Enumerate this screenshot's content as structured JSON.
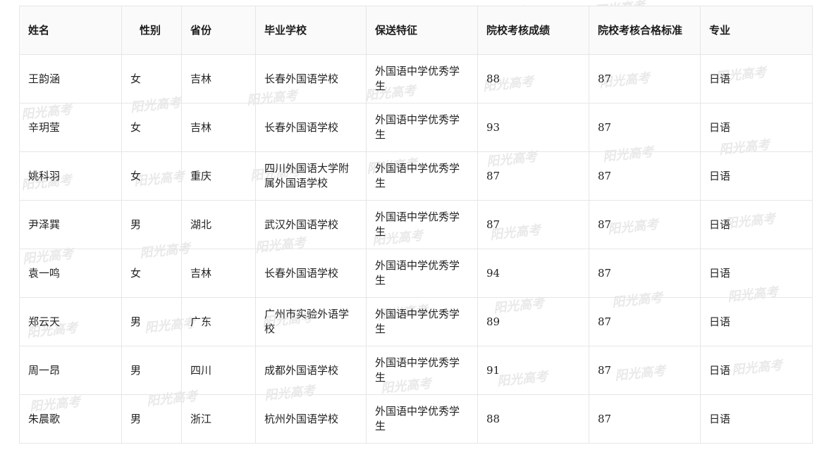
{
  "table": {
    "headers": [
      "姓名",
      "性别",
      "省份",
      "毕业学校",
      "保送特征",
      "院校考核成绩",
      "院校考核合格标准",
      "专业"
    ],
    "rows": [
      [
        "王韵涵",
        "女",
        "吉林",
        "长春外国语学校",
        "外国语中学优秀学生",
        "88",
        "87",
        "日语"
      ],
      [
        "辛玥莹",
        "女",
        "吉林",
        "长春外国语学校",
        "外国语中学优秀学生",
        "93",
        "87",
        "日语"
      ],
      [
        "姚科羽",
        "女",
        "重庆",
        "四川外国语大学附属外国语学校",
        "外国语中学优秀学生",
        "87",
        "87",
        "日语"
      ],
      [
        "尹泽巽",
        "男",
        "湖北",
        "武汉外国语学校",
        "外国语中学优秀学生",
        "87",
        "87",
        "日语"
      ],
      [
        "袁一鸣",
        "女",
        "吉林",
        "长春外国语学校",
        "外国语中学优秀学生",
        "94",
        "87",
        "日语"
      ],
      [
        "郑云天",
        "男",
        "广东",
        "广州市实验外语学校",
        "外国语中学优秀学生",
        "89",
        "87",
        "日语"
      ],
      [
        "周一昂",
        "男",
        "四川",
        "成都外国语学校",
        "外国语中学优秀学生",
        "91",
        "87",
        "日语"
      ],
      [
        "朱晨歌",
        "男",
        "浙江",
        "杭州外国语学校",
        "外国语中学优秀学生",
        "88",
        "87",
        "日语"
      ]
    ]
  },
  "watermark_text": "阳光高考"
}
